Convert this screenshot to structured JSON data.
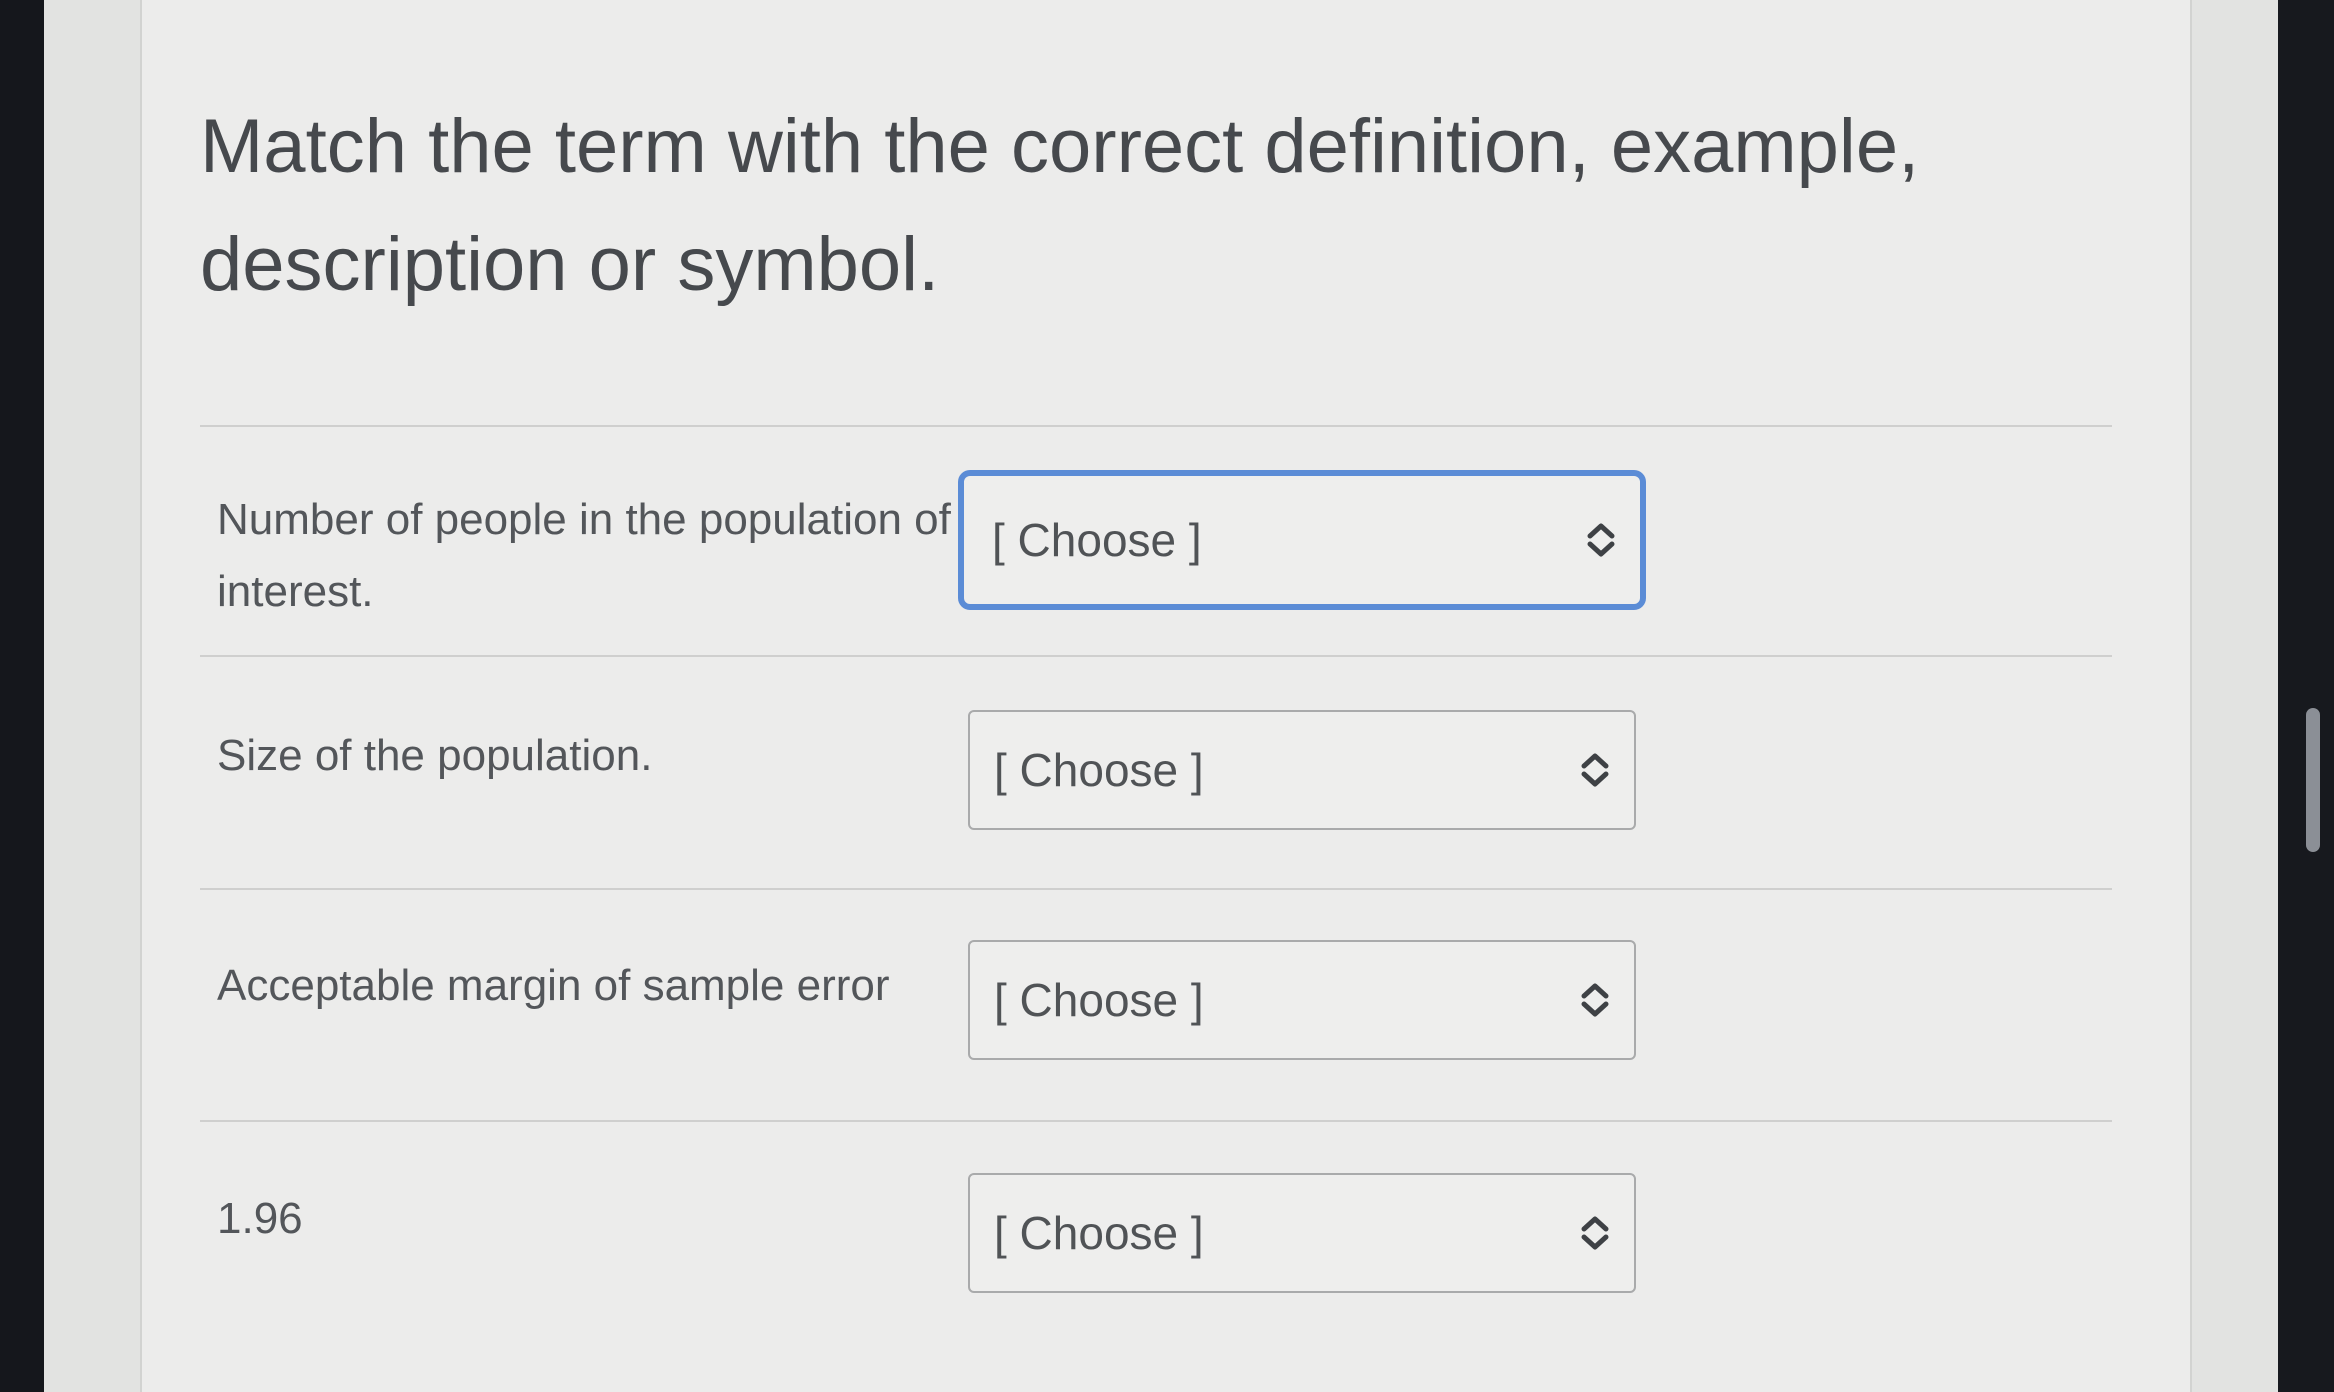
{
  "question": {
    "title": "Match the term with the correct definition, example, description or symbol."
  },
  "rows": [
    {
      "label": "Number of people in the population of interest.",
      "select_value": "[ Choose ]"
    },
    {
      "label": "Size of the population.",
      "select_value": "[ Choose ]"
    },
    {
      "label": "Acceptable margin of sample error",
      "select_value": "[ Choose ]"
    },
    {
      "label": "1.96",
      "select_value": "[ Choose ]"
    }
  ],
  "icons": {
    "select_icon": "chevron-up-down-icon"
  },
  "colors": {
    "focus_ring": "#5b8cd6",
    "text": "#46494d",
    "background": "#ececeb"
  }
}
